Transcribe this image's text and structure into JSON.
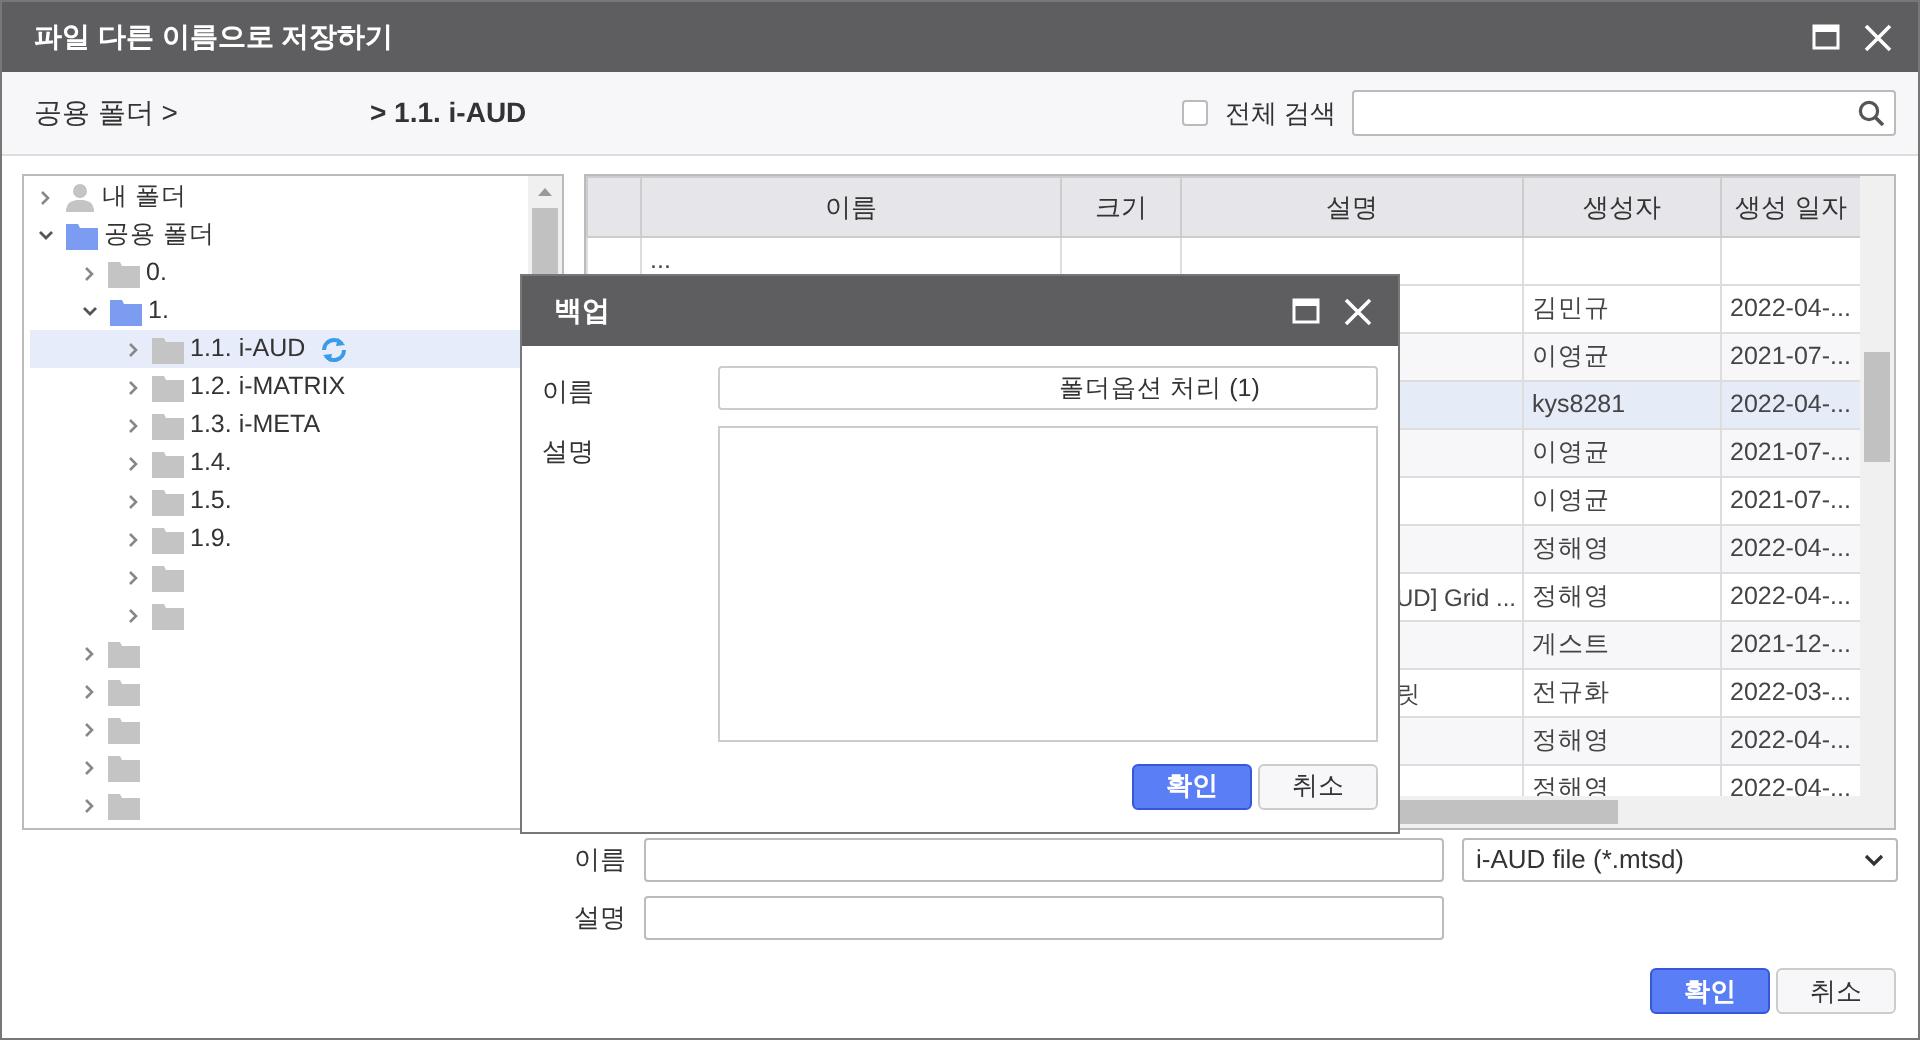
{
  "window": {
    "title": "파일 다른 이름으로 저장하기"
  },
  "breadcrumb": [
    {
      "label": "공용 폴더 >",
      "current": false
    },
    {
      "label": "> 1.1. i-AUD",
      "current": true
    }
  ],
  "search": {
    "scope_label": "전체 검색",
    "checked": false
  },
  "tree": [
    {
      "label": "내 폴더",
      "kind": "user",
      "expanded": false,
      "selected": false
    },
    {
      "label": "공용 폴더",
      "kind": "folder",
      "expanded": true,
      "selected": false,
      "children": [
        {
          "label": "0.",
          "kind": "folder",
          "expanded": false,
          "selected": false
        },
        {
          "label": "1.",
          "kind": "folder",
          "expanded": true,
          "selected": false,
          "children": [
            {
              "label": "1.1. i-AUD",
              "kind": "folder",
              "expanded": false,
              "selected": true,
              "syncing": true
            },
            {
              "label": "1.2. i-MATRIX",
              "kind": "folder",
              "expanded": false,
              "selected": false
            },
            {
              "label": "1.3. i-META",
              "kind": "folder",
              "expanded": false,
              "selected": false
            },
            {
              "label": "1.4.",
              "kind": "folder",
              "expanded": false,
              "selected": false
            },
            {
              "label": "1.5.",
              "kind": "folder",
              "expanded": false,
              "selected": false
            },
            {
              "label": "1.9.",
              "kind": "folder",
              "expanded": false,
              "selected": false
            },
            {
              "kind": "folder",
              "expanded": false,
              "selected": false
            },
            {
              "kind": "folder",
              "expanded": false,
              "selected": false
            }
          ]
        },
        {
          "kind": "folder",
          "expanded": false,
          "selected": false
        },
        {
          "kind": "folder",
          "expanded": false,
          "selected": false
        },
        {
          "kind": "folder",
          "expanded": false,
          "selected": false
        },
        {
          "kind": "folder",
          "expanded": false,
          "selected": false
        },
        {
          "kind": "folder",
          "expanded": false,
          "selected": false
        }
      ]
    }
  ],
  "table": {
    "columns": [
      "이름",
      "크기",
      "설명",
      "생성자",
      "생성 일자"
    ],
    "rows": [
      {
        "name": "...",
        "selected": false
      },
      {
        "creator": "김민규",
        "date": "2022-04-...",
        "selected": false
      },
      {
        "creator": "이영균",
        "date": "2021-07-...",
        "selected": false
      },
      {
        "creator": "kys8281",
        "date": "2022-04-...",
        "selected": true
      },
      {
        "creator": "이영균",
        "date": "2021-07-...",
        "selected": false
      },
      {
        "creator": "이영균",
        "date": "2021-07-...",
        "selected": false
      },
      {
        "creator": "정해영",
        "date": "2022-04-...",
        "selected": false
      },
      {
        "description": "UD] Grid ...",
        "creator": "정해영",
        "date": "2022-04-...",
        "selected": false
      },
      {
        "creator": "게스트",
        "date": "2021-12-...",
        "selected": false
      },
      {
        "description": "릿",
        "creator": "전규화",
        "date": "2022-03-...",
        "selected": false
      },
      {
        "creator": "정해영",
        "date": "2022-04-...",
        "selected": false
      },
      {
        "creator": "정해영",
        "date": "2022-04-...",
        "selected": false
      }
    ]
  },
  "form": {
    "name_label": "이름",
    "description_label": "설명",
    "file_type": "i-AUD file (*.mtsd)",
    "buttons": [
      {
        "label": "확인",
        "kind": "primary"
      },
      {
        "label": "취소",
        "kind": "secondary"
      }
    ]
  },
  "backup_dialog": {
    "title": "백업",
    "name_label": "이름",
    "name_value": "폴더옵션 처리 (1)",
    "description_label": "설명",
    "buttons": [
      {
        "label": "확인",
        "kind": "primary"
      },
      {
        "label": "취소",
        "kind": "secondary"
      }
    ]
  }
}
